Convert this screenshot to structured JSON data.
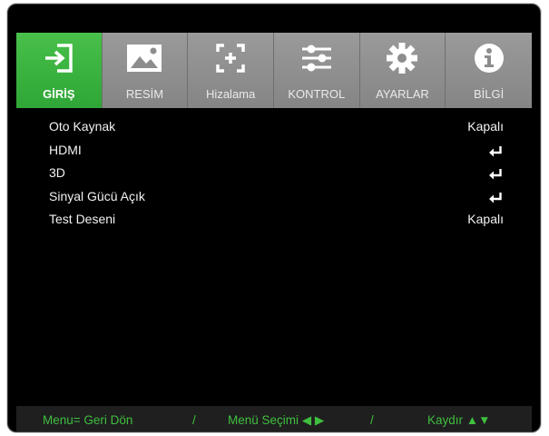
{
  "tabs": [
    {
      "label": "GİRİŞ",
      "icon": "input-icon",
      "active": true
    },
    {
      "label": "RESİM",
      "icon": "picture-icon",
      "active": false
    },
    {
      "label": "Hizalama",
      "icon": "alignment-icon",
      "active": false
    },
    {
      "label": "KONTROL",
      "icon": "sliders-icon",
      "active": false
    },
    {
      "label": "AYARLAR",
      "icon": "gear-icon",
      "active": false
    },
    {
      "label": "BİLGİ",
      "icon": "info-icon",
      "active": false
    }
  ],
  "menu": {
    "items": [
      {
        "label": "Oto Kaynak",
        "value": "Kapalı"
      },
      {
        "label": "HDMI",
        "value_icon": "enter-icon"
      },
      {
        "label": "3D",
        "value_icon": "enter-icon"
      },
      {
        "label": "Sinyal Gücü Açık",
        "value_icon": "enter-icon"
      },
      {
        "label": "Test Deseni",
        "value": "Kapalı"
      }
    ]
  },
  "footer": {
    "back": "Menu= Geri Dön",
    "sep1": "/",
    "select": "Menü Seçimi ◀ ▶",
    "sep2": "/",
    "scroll": "Kaydır ▲▼"
  },
  "colors": {
    "active_tab": "#3db441",
    "tab_bg": "#8d8d8d",
    "footer_text": "#3fbf3f",
    "background": "#000000"
  }
}
